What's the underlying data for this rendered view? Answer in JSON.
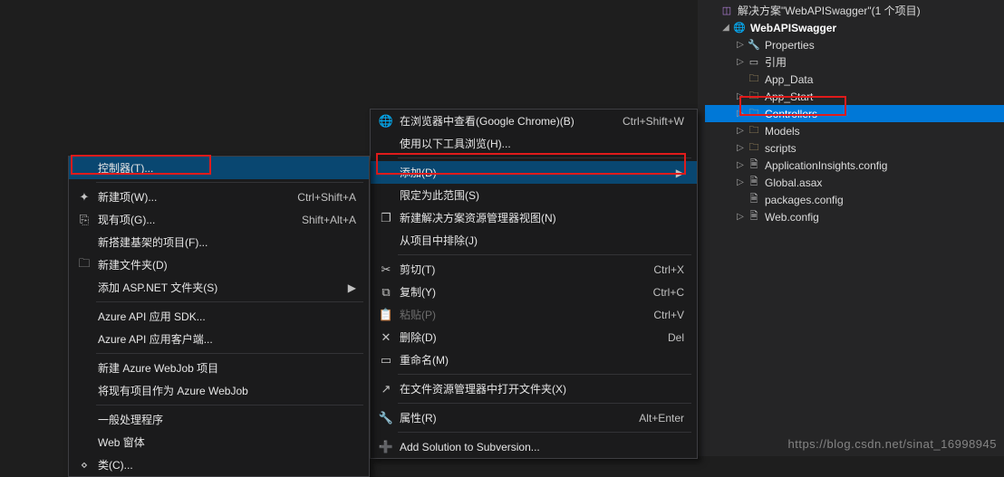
{
  "solution": {
    "title": "解决方案\"WebAPISwagger\"(1 个项目)",
    "project": "WebAPISwagger",
    "nodes": {
      "properties": "Properties",
      "references": "引用",
      "app_data": "App_Data",
      "app_start": "App_Start",
      "controllers": "Controllers",
      "models": "Models",
      "scripts": "scripts",
      "appinsights": "ApplicationInsights.config",
      "globalasax": "Global.asax",
      "packages": "packages.config",
      "webconfig": "Web.config"
    }
  },
  "menuA": {
    "items": [
      {
        "label": "控制器(T)...",
        "sel": true
      },
      {
        "sep": true
      },
      {
        "label": "新建项(W)...",
        "shortcut": "Ctrl+Shift+A",
        "icon": "new-item"
      },
      {
        "label": "现有项(G)...",
        "shortcut": "Shift+Alt+A",
        "icon": "existing-item"
      },
      {
        "label": "新搭建基架的项目(F)..."
      },
      {
        "label": "新建文件夹(D)",
        "icon": "new-folder"
      },
      {
        "label": "添加 ASP.NET 文件夹(S)",
        "arrow": true
      },
      {
        "sep": true
      },
      {
        "label": "Azure API 应用 SDK..."
      },
      {
        "label": "Azure API 应用客户端..."
      },
      {
        "sep": true
      },
      {
        "label": "新建 Azure WebJob 项目"
      },
      {
        "label": "将现有项目作为 Azure WebJob"
      },
      {
        "sep": true
      },
      {
        "label": "一般处理程序"
      },
      {
        "label": "Web 窗体"
      },
      {
        "label": "类(C)...",
        "icon": "class"
      }
    ]
  },
  "menuB": {
    "items": [
      {
        "label": "在浏览器中查看(Google Chrome)(B)",
        "shortcut": "Ctrl+Shift+W",
        "icon": "browser"
      },
      {
        "label": "使用以下工具浏览(H)..."
      },
      {
        "sep": true
      },
      {
        "label": "添加(D)",
        "arrow": true,
        "sel": true
      },
      {
        "label": "限定为此范围(S)"
      },
      {
        "label": "新建解决方案资源管理器视图(N)",
        "icon": "new-view"
      },
      {
        "label": "从项目中排除(J)"
      },
      {
        "sep": true
      },
      {
        "label": "剪切(T)",
        "shortcut": "Ctrl+X",
        "icon": "cut"
      },
      {
        "label": "复制(Y)",
        "shortcut": "Ctrl+C",
        "icon": "copy"
      },
      {
        "label": "粘贴(P)",
        "shortcut": "Ctrl+V",
        "icon": "paste",
        "disabled": true
      },
      {
        "label": "删除(D)",
        "shortcut": "Del",
        "icon": "delete"
      },
      {
        "label": "重命名(M)",
        "icon": "rename"
      },
      {
        "sep": true
      },
      {
        "label": "在文件资源管理器中打开文件夹(X)",
        "icon": "open-folder"
      },
      {
        "sep": true
      },
      {
        "label": "属性(R)",
        "shortcut": "Alt+Enter",
        "icon": "properties"
      },
      {
        "sep": true
      },
      {
        "label": "Add Solution to Subversion...",
        "icon": "svn"
      }
    ]
  },
  "watermark": "https://blog.csdn.net/sinat_16998945"
}
